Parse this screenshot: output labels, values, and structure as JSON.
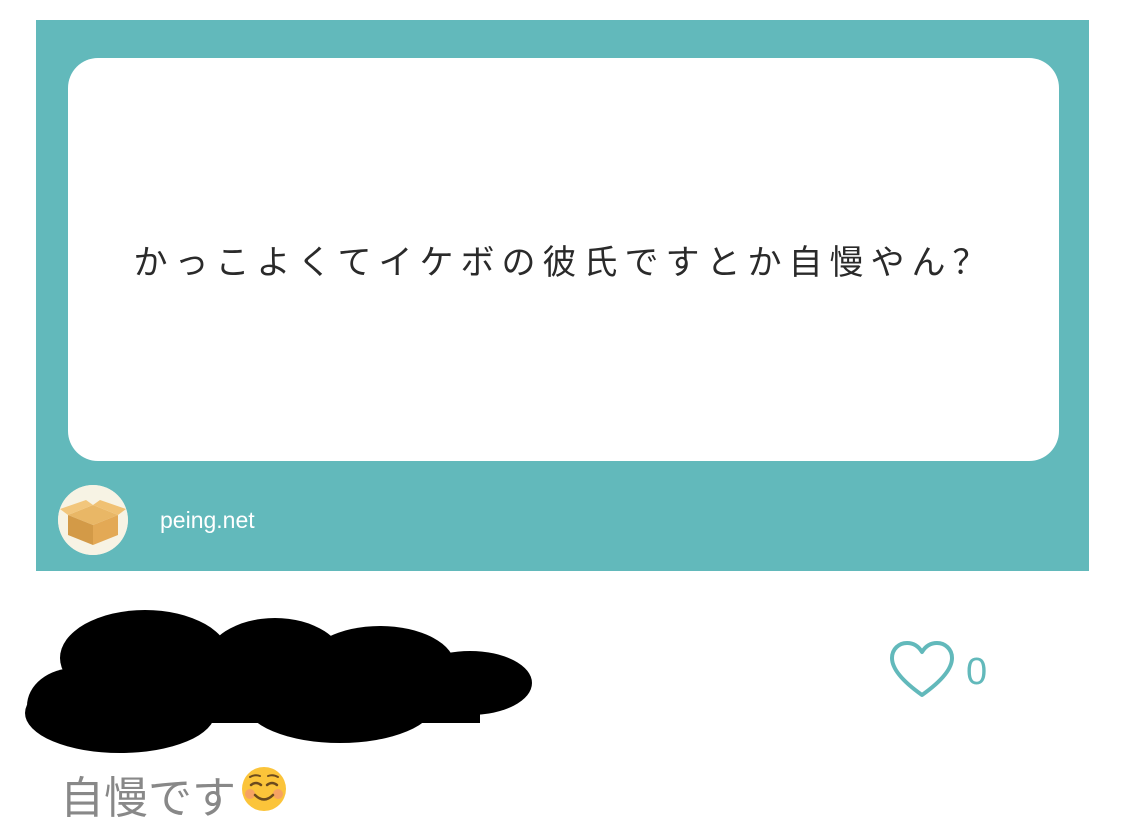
{
  "question": {
    "text": "かっこよくてイケボの彼氏ですとか自慢やん？"
  },
  "footer": {
    "site": "peing.net",
    "avatar_icon": "cardboard-box-icon"
  },
  "like": {
    "icon": "heart-icon",
    "count": "0"
  },
  "answer": {
    "text": "自慢です",
    "emoji_icon": "smiling-face-icon"
  },
  "colors": {
    "card_bg": "#62b9bb",
    "answer_text": "#888888"
  }
}
